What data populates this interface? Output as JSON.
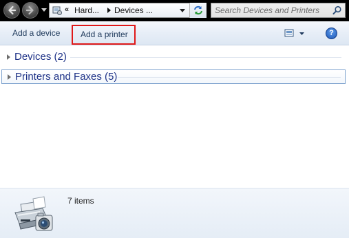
{
  "navigation": {
    "back_icon": "back-arrow-icon",
    "forward_icon": "forward-arrow-icon",
    "recent_pages_icon": "chevron-down-icon"
  },
  "address_bar": {
    "location_icon": "control-panel-icon",
    "overflow": "«",
    "breadcrumbs": [
      "Hard...",
      "Devices ..."
    ],
    "dropdown_icon": "chevron-down-icon",
    "refresh_icon": "refresh-icon"
  },
  "search": {
    "placeholder": "Search Devices and Printers",
    "value": "",
    "icon": "search-icon"
  },
  "command_bar": {
    "add_device": "Add a device",
    "add_printer": "Add a printer",
    "highlight_color": "#e01818",
    "view_icon": "change-view-icon",
    "help_label": "?"
  },
  "groups": [
    {
      "label": "Devices (2)",
      "expanded": false
    },
    {
      "label": "Printers and Faxes (5)",
      "expanded": false,
      "selected": true
    }
  ],
  "details_pane": {
    "icon": "printer-camera-icon",
    "item_count": "7 items"
  },
  "colors": {
    "nav_background": "#000000",
    "group_title": "#1e3287",
    "command_text": "#1e395b"
  }
}
